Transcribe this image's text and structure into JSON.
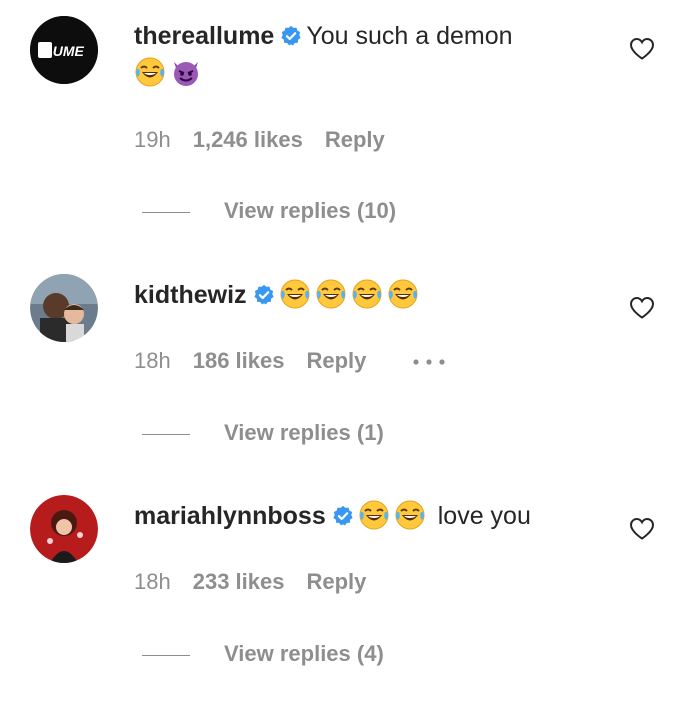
{
  "comments": [
    {
      "username": "thereallume",
      "text_line1": "You such a demon",
      "emoji": [
        "face-with-tears-of-joy",
        "smiling-imp"
      ],
      "time": "19h",
      "likes": "1,246 likes",
      "reply": "Reply",
      "view_replies": "View replies (10)",
      "avatar_text": "LUME"
    },
    {
      "username": "kidthewiz",
      "emoji": [
        "face-with-tears-of-joy",
        "face-with-tears-of-joy",
        "face-with-tears-of-joy",
        "face-with-tears-of-joy"
      ],
      "time": "18h",
      "likes": "186 likes",
      "reply": "Reply",
      "view_replies": "View replies (1)"
    },
    {
      "username": "mariahlynnboss",
      "emoji": [
        "face-with-tears-of-joy",
        "face-with-tears-of-joy"
      ],
      "text_after": "love you",
      "time": "18h",
      "likes": "233 likes",
      "reply": "Reply",
      "view_replies": "View replies (4)"
    }
  ],
  "colors": {
    "verified": "#3897f0",
    "muted": "#8e8e8e",
    "text": "#262626"
  }
}
